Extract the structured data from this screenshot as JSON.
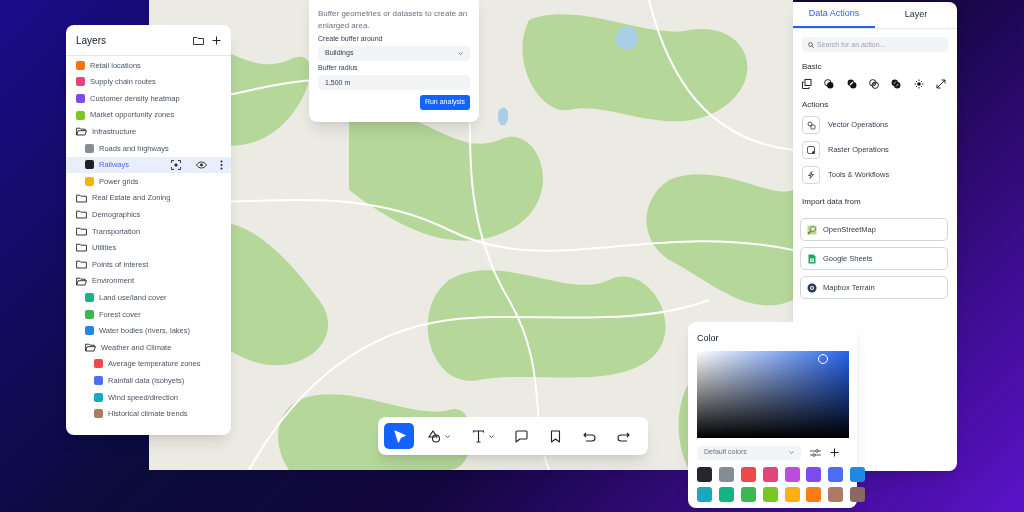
{
  "layers_panel": {
    "title": "Layers",
    "items": [
      {
        "kind": "layer",
        "label": "Retail locations",
        "color": "#f97316",
        "selected": false
      },
      {
        "kind": "layer",
        "label": "Supply chain routes",
        "color": "#e2457a",
        "selected": false
      },
      {
        "kind": "layer",
        "label": "Customer density heatmap",
        "color": "#7c4dea",
        "selected": false
      },
      {
        "kind": "layer",
        "label": "Market opportunity zones",
        "color": "#7cc522",
        "selected": false
      },
      {
        "kind": "group",
        "label": "Infrastructure",
        "expanded": true,
        "selected": false,
        "children": [
          {
            "kind": "layer",
            "label": "Roads and highways",
            "color": "#868c94",
            "selected": false
          },
          {
            "kind": "layer",
            "label": "Railways",
            "color": "#1f2125",
            "selected": true
          },
          {
            "kind": "layer",
            "label": "Power grids",
            "color": "#fbb00f",
            "selected": false
          }
        ]
      },
      {
        "kind": "group",
        "label": "Real Estate and Zoning",
        "expanded": false,
        "selected": false
      },
      {
        "kind": "group",
        "label": "Demographics",
        "expanded": false,
        "selected": false
      },
      {
        "kind": "group",
        "label": "Transportation",
        "expanded": false,
        "selected": false
      },
      {
        "kind": "group",
        "label": "Utilities",
        "expanded": false,
        "selected": false
      },
      {
        "kind": "group",
        "label": "Points of Interest",
        "expanded": false,
        "selected": false
      },
      {
        "kind": "group",
        "label": "Environment",
        "expanded": true,
        "selected": false,
        "children": [
          {
            "kind": "layer",
            "label": "Land use/land cover",
            "color": "#17b583",
            "selected": false
          },
          {
            "kind": "layer",
            "label": "Forest cover",
            "color": "#3bb851",
            "selected": false
          },
          {
            "kind": "layer",
            "label": "Water bodies (rivers, lakes)",
            "color": "#1e88e5",
            "selected": false
          },
          {
            "kind": "group",
            "label": "Weather and Climate",
            "expanded": true,
            "selected": false,
            "children": [
              {
                "kind": "layer",
                "label": "Average temperature zones",
                "color": "#f04848",
                "selected": false
              },
              {
                "kind": "layer",
                "label": "Rainfall data (isohyets)",
                "color": "#4c6ef5",
                "selected": false
              },
              {
                "kind": "layer",
                "label": "Wind speed/direction",
                "color": "#18a8bf",
                "selected": false
              },
              {
                "kind": "layer",
                "label": "Historical climate trends",
                "color": "#ad7a66",
                "selected": false
              }
            ]
          }
        ]
      }
    ]
  },
  "buffer_panel": {
    "description": "Buffer geometries or datasets to create an enlarged area.",
    "fields": [
      {
        "label": "Create buffer around",
        "kind": "select",
        "value": "Buildings"
      },
      {
        "label": "Buffer radius",
        "kind": "text",
        "value": "1,500 m"
      }
    ],
    "button": "Run analysis"
  },
  "toolbar": {
    "tools": [
      {
        "kind": "pointer",
        "selected": true,
        "dropdown": false
      },
      {
        "kind": "shapes",
        "selected": false,
        "dropdown": true
      },
      {
        "kind": "text",
        "selected": false,
        "dropdown": true
      },
      {
        "kind": "comment",
        "selected": false,
        "dropdown": false
      },
      {
        "kind": "bookmark",
        "selected": false,
        "dropdown": false
      },
      {
        "kind": "undo",
        "selected": false,
        "dropdown": false
      },
      {
        "kind": "redo",
        "selected": false,
        "dropdown": false
      }
    ]
  },
  "side_panel": {
    "tabs": [
      {
        "label": "Data Actions",
        "selected": true
      },
      {
        "label": "Layer",
        "selected": false
      }
    ],
    "search": {
      "placeholder": "Search for an action..."
    },
    "basic_title": "Basic",
    "actions_title": "Actions",
    "actions": [
      {
        "kind": "vector",
        "label": "Vector Operations"
      },
      {
        "kind": "raster",
        "label": "Raster Operations"
      },
      {
        "kind": "tools",
        "label": "Tools & Workflows"
      }
    ],
    "import_title": "Import data from",
    "imports": [
      {
        "kind": "osm",
        "label": "OpenStreetMap"
      },
      {
        "kind": "sheets",
        "label": "Google Sheets"
      },
      {
        "kind": "mapbox",
        "label": "Mapbox Terrain"
      }
    ]
  },
  "color_panel": {
    "title": "Color",
    "palette_select": "Default colors",
    "swatches": [
      {
        "color": "#25272c"
      },
      {
        "color": "#868c94"
      },
      {
        "color": "#f04848"
      },
      {
        "color": "#e2457a"
      },
      {
        "color": "#bd4ddb"
      },
      {
        "color": "#7c4dea"
      },
      {
        "color": "#4c6ef5"
      },
      {
        "color": "#1e88e5"
      },
      {
        "color": "#18a8bf"
      },
      {
        "color": "#12b584"
      },
      {
        "color": "#3bb851"
      },
      {
        "color": "#7cc522"
      },
      {
        "color": "#fbb00f"
      },
      {
        "color": "#fb7c14"
      },
      {
        "color": "#ad7a66"
      },
      {
        "color": "#8a6a5e"
      }
    ]
  }
}
